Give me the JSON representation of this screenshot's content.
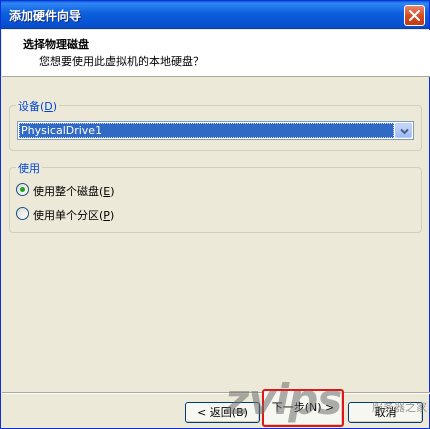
{
  "window": {
    "title": "添加硬件向导"
  },
  "header": {
    "title": "选择物理磁盘",
    "subtitle": "您想要使用此虚拟机的本地硬盘？"
  },
  "device_group": {
    "label": "设备",
    "mnemonic": "D",
    "selected": "PhysicalDrive1"
  },
  "usage_group": {
    "label": "使用",
    "options": [
      {
        "label": "使用整个磁盘",
        "mnemonic": "E",
        "checked": true
      },
      {
        "label": "使用单个分区",
        "mnemonic": "P",
        "checked": false
      }
    ]
  },
  "buttons": {
    "back": "< 返回(B)",
    "next": "下一步(N) >",
    "cancel": "取消"
  },
  "watermark": {
    "text": "zvips",
    "subtext": "服务器之家"
  },
  "colors": {
    "accent": "#316ac5",
    "title_bar": "#0a5ddb",
    "focus_highlight": "#e0161a"
  },
  "icons": {
    "close": "close-icon",
    "dropdown": "chevron-down-icon"
  }
}
